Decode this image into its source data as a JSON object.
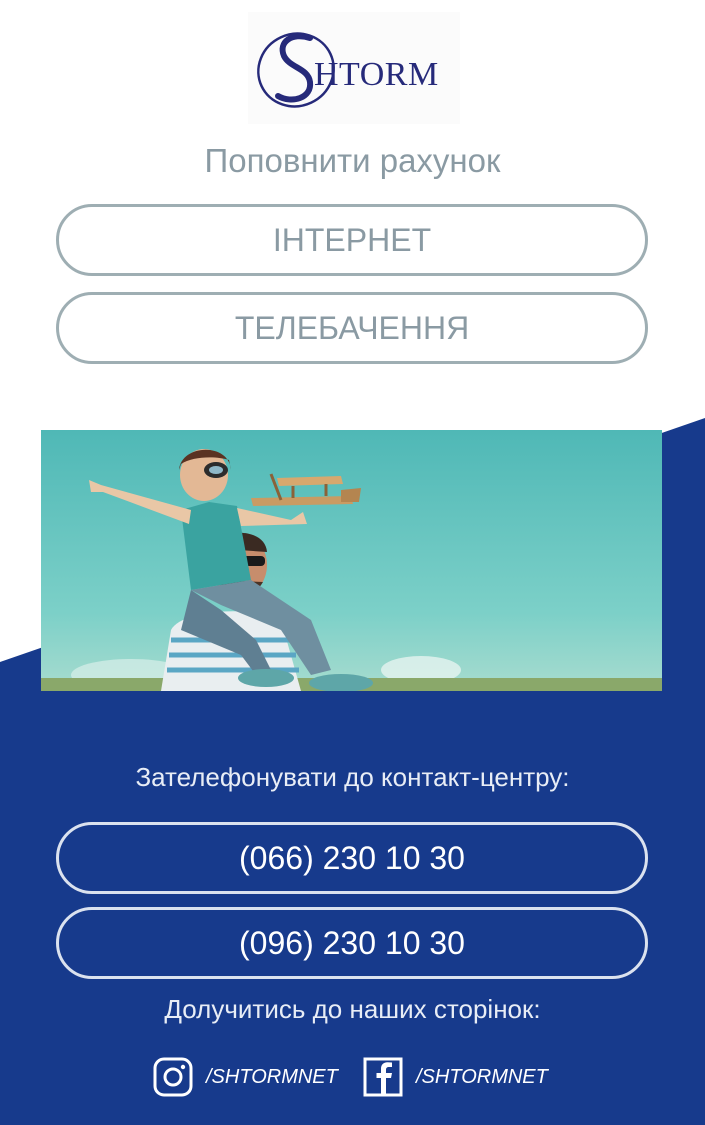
{
  "brand": {
    "logo_text": "HTORM"
  },
  "top_up": {
    "title": "Поповнити рахунок",
    "buttons": [
      {
        "label": "ІНТЕРНЕТ"
      },
      {
        "label": "ТЕЛЕБАЧЕННЯ"
      }
    ]
  },
  "contact": {
    "title": "Зателефонувати до контакт-центру:",
    "phones": [
      {
        "label": "(066) 230 10 30"
      },
      {
        "label": "(096) 230 10 30"
      }
    ]
  },
  "social": {
    "title": "Долучитись до наших сторінок:",
    "links": [
      {
        "icon": "instagram-icon",
        "handle": "/SHTORMNET"
      },
      {
        "icon": "facebook-icon",
        "handle": "/SHTORMNET"
      }
    ]
  },
  "colors": {
    "brand_blue": "#173a8c",
    "logo_blue": "#262a7a",
    "grey_text": "#8a9aa3",
    "grey_border": "#9eaeb3",
    "sky": "#5fc0bd"
  }
}
